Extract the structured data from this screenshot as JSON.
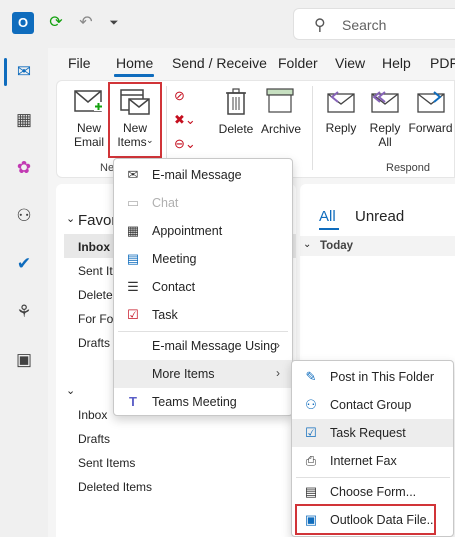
{
  "search": {
    "placeholder": "Search"
  },
  "ribbon_tabs": [
    "File",
    "Home",
    "Send / Receive",
    "Folder",
    "View",
    "Help",
    "PDF-"
  ],
  "ribbon": {
    "new_email": [
      "New",
      "Email"
    ],
    "new_items": [
      "New",
      "Items"
    ],
    "delete": "Delete",
    "archive": "Archive",
    "reply": "Reply",
    "reply_all": [
      "Reply",
      "All"
    ],
    "forward": "Forward",
    "group_new": "Ne",
    "group_respond": "Respond"
  },
  "folders": {
    "favorites_header": "Favor",
    "favorites": [
      "Inbox",
      "Sent It",
      "Delete",
      "For Fo",
      "Drafts"
    ],
    "account": [
      "Inbox",
      "Drafts",
      "Sent Items",
      "Deleted Items"
    ]
  },
  "message_list": {
    "tab_all": "All",
    "tab_unread": "Unread",
    "group_today": "Today"
  },
  "new_items_menu": [
    {
      "label": "E-mail Message",
      "icon": "envelope-icon"
    },
    {
      "label": "Chat",
      "icon": "chat-icon",
      "disabled": true
    },
    {
      "label": "Appointment",
      "icon": "calendar-icon"
    },
    {
      "label": "Meeting",
      "icon": "meeting-icon"
    },
    {
      "label": "Contact",
      "icon": "contact-card-icon"
    },
    {
      "label": "Task",
      "icon": "task-clipboard-icon"
    },
    {
      "label": "E-mail Message Using",
      "submenu": true
    },
    {
      "label": "More Items",
      "submenu": true
    },
    {
      "label": "Teams Meeting",
      "icon": "teams-icon"
    }
  ],
  "more_items_menu": [
    {
      "label": "Post in This Folder",
      "icon": "post-icon"
    },
    {
      "label": "Contact Group",
      "icon": "contact-group-icon"
    },
    {
      "label": "Task Request",
      "icon": "task-request-icon"
    },
    {
      "label": "Internet Fax",
      "icon": "fax-icon"
    },
    {
      "label": "Choose Form...",
      "icon": "form-icon"
    },
    {
      "label": "Outlook Data File...",
      "icon": "data-file-icon"
    }
  ],
  "colors": {
    "accent": "#0f6cbd",
    "highlight_box": "#d13438"
  }
}
